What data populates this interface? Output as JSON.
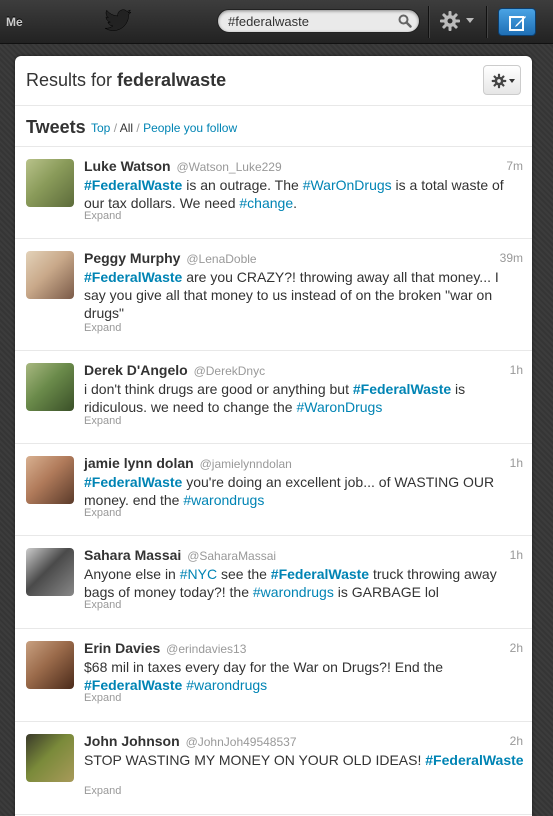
{
  "topbar": {
    "me_label": "Me",
    "search_value": "#federalwaste"
  },
  "results": {
    "prefix": "Results for ",
    "query": "federalwaste"
  },
  "stream": {
    "heading": "Tweets",
    "filter_top": "Top",
    "filter_sep1": " / ",
    "filter_all": "All",
    "filter_sep2": " / ",
    "filter_people": "People you follow"
  },
  "colors": {
    "link": "#0084b4",
    "compose": "#2b84d0"
  },
  "tweets": [
    {
      "name": "Luke Watson",
      "handle": "@Watson_Luke229",
      "time": "7m",
      "parts": [
        {
          "t": "#FederalWaste",
          "k": "tagb"
        },
        {
          "t": " is an outrage. The ",
          "k": ""
        },
        {
          "t": "#WarOnDrugs",
          "k": "tag"
        },
        {
          "t": " is a total waste of our tax dollars. We need ",
          "k": ""
        },
        {
          "t": "#change",
          "k": "tag"
        },
        {
          "t": ".",
          "k": ""
        }
      ],
      "expand": "Expand"
    },
    {
      "name": "Peggy Murphy",
      "handle": "@LenaDoble",
      "time": "39m",
      "parts": [
        {
          "t": "#FederalWaste",
          "k": "tagb"
        },
        {
          "t": " are you CRAZY?! throwing away all that money... I say you give all that money to us instead of on the broken \"war on drugs\"",
          "k": ""
        }
      ],
      "expand": "Expand"
    },
    {
      "name": "Derek D'Angelo",
      "handle": "@DerekDnyc",
      "time": "1h",
      "parts": [
        {
          "t": "i don't think drugs are good or anything but ",
          "k": ""
        },
        {
          "t": "#FederalWaste",
          "k": "tagb"
        },
        {
          "t": " is ridiculous. we need to change the ",
          "k": ""
        },
        {
          "t": "#WaronDrugs",
          "k": "tag"
        }
      ],
      "expand": "Expand"
    },
    {
      "name": "jamie lynn dolan",
      "handle": "@jamielynndolan",
      "time": "1h",
      "parts": [
        {
          "t": "#FederalWaste",
          "k": "tagb"
        },
        {
          "t": " you're doing an excellent job... of WASTING OUR money. end the ",
          "k": ""
        },
        {
          "t": "#warondrugs",
          "k": "tag"
        }
      ],
      "expand": "Expand"
    },
    {
      "name": "Sahara Massai",
      "handle": "@SaharaMassai",
      "time": "1h",
      "parts": [
        {
          "t": "Anyone else in ",
          "k": ""
        },
        {
          "t": "#NYC",
          "k": "tag"
        },
        {
          "t": " see the ",
          "k": ""
        },
        {
          "t": "#FederalWaste",
          "k": "tagb"
        },
        {
          "t": " truck throwing away bags of money today?! the ",
          "k": ""
        },
        {
          "t": "#warondrugs",
          "k": "tag"
        },
        {
          "t": " is GARBAGE lol",
          "k": ""
        }
      ],
      "expand": "Expand"
    },
    {
      "name": "Erin Davies",
      "handle": "@erindavies13",
      "time": "2h",
      "parts": [
        {
          "t": "$68 mil in taxes every day for the War on Drugs?! End the ",
          "k": ""
        },
        {
          "t": "#FederalWaste",
          "k": "tagb"
        },
        {
          "t": " ",
          "k": ""
        },
        {
          "t": "#warondrugs",
          "k": "tag"
        }
      ],
      "expand": "Expand"
    },
    {
      "name": "John Johnson",
      "handle": "@JohnJoh49548537",
      "time": "2h",
      "parts": [
        {
          "t": "STOP WASTING MY MONEY ON YOUR OLD IDEAS! ",
          "k": ""
        },
        {
          "t": "#FederalWaste",
          "k": "tagb"
        }
      ],
      "expand": "Expand"
    }
  ]
}
